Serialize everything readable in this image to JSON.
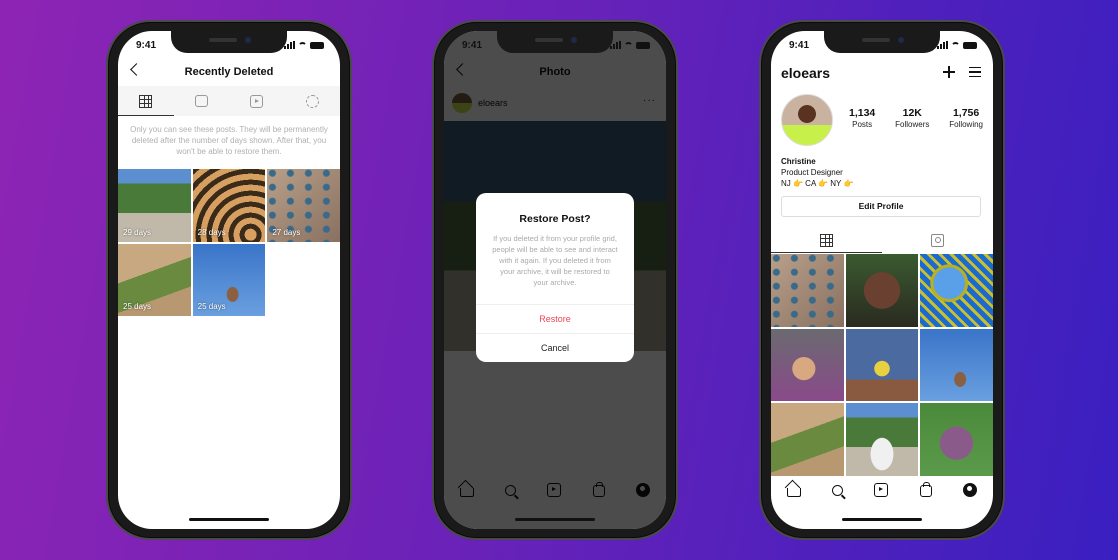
{
  "status": {
    "time": "9:41"
  },
  "phone1": {
    "title": "Recently Deleted",
    "tabs": [
      {
        "name": "grid",
        "icon": "grid-icon",
        "active": true
      },
      {
        "name": "igtv",
        "icon": "igtv-icon",
        "active": false
      },
      {
        "name": "reels",
        "icon": "reels-icon",
        "active": false
      },
      {
        "name": "stories",
        "icon": "stories-icon",
        "active": false
      }
    ],
    "note": "Only you can see these posts. They will be permanently deleted after the number of days shown. After that, you won't be able to restore them.",
    "items": [
      {
        "days": "29 days",
        "subject": "white dog on path"
      },
      {
        "days": "28 days",
        "subject": "shadow pattern"
      },
      {
        "days": "27 days",
        "subject": "climbing wall"
      },
      {
        "days": "25 days",
        "subject": "grass"
      },
      {
        "days": "25 days",
        "subject": "ice cream cone sky"
      }
    ]
  },
  "phone2": {
    "title": "Photo",
    "username": "eloears",
    "dialog": {
      "title": "Restore Post?",
      "body": "If you deleted it from your profile grid, people will be able to see and interact with it again. If you deleted it from your archive, it will be restored to your archive.",
      "restore": "Restore",
      "cancel": "Cancel"
    }
  },
  "phone3": {
    "username": "eloears",
    "stats": [
      {
        "value": "1,134",
        "label": "Posts"
      },
      {
        "value": "12K",
        "label": "Followers"
      },
      {
        "value": "1,756",
        "label": "Following"
      }
    ],
    "bio": {
      "name": "Christine",
      "role": "Product Designer",
      "places": "NJ 👉 CA 👉 NY 👉"
    },
    "edit_profile": "Edit Profile"
  },
  "colors": {
    "accent_red": "#ed4956",
    "bg_left": "#8e24b4",
    "bg_right": "#3a1fc0"
  }
}
